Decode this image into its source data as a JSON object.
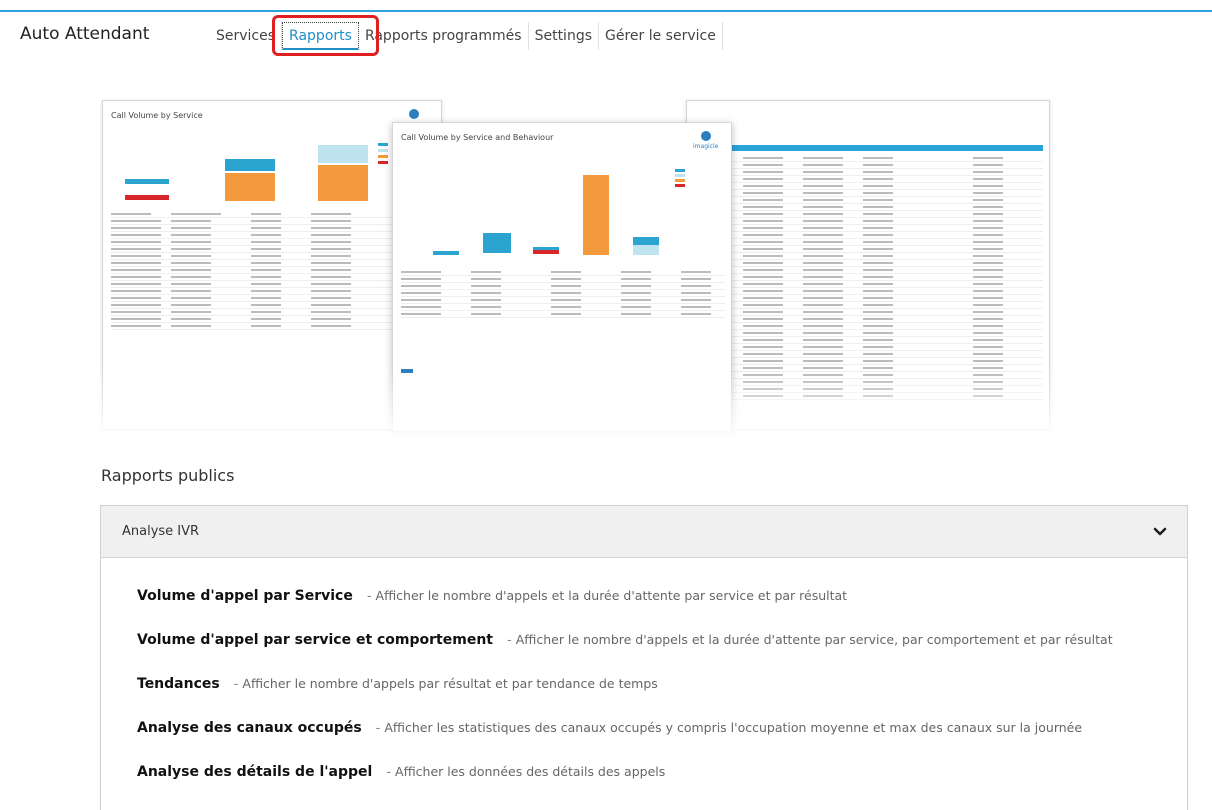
{
  "app": {
    "title": "Auto Attendant"
  },
  "nav": {
    "tabs": [
      {
        "label": "Services",
        "active": false
      },
      {
        "label": "Rapports",
        "active": true
      },
      {
        "label": "Rapports programmés",
        "active": false
      },
      {
        "label": "Settings",
        "active": false
      },
      {
        "label": "Gérer le service",
        "active": false
      }
    ]
  },
  "preview": {
    "left_doc_title": "Call Volume by Service",
    "center_doc_title": "Call Volume by Service and Behaviour",
    "logo_text": "imagicle"
  },
  "section": {
    "title": "Rapports publics"
  },
  "panel": {
    "title": "Analyse IVR",
    "reports": [
      {
        "name": "Volume d'appel par Service",
        "separator": "-",
        "description": "Afficher le nombre d'appels et la durée d'attente par service et par résultat"
      },
      {
        "name": "Volume d'appel par service et comportement",
        "separator": "-",
        "description": "Afficher le nombre d'appels et la durée d'attente par service, par comportement et par résultat"
      },
      {
        "name": "Tendances",
        "separator": "-",
        "description": "Afficher le nombre d'appels par résultat et par tendance de temps"
      },
      {
        "name": "Analyse des canaux occupés",
        "separator": "-",
        "description": "Afficher les statistiques des canaux occupés y compris l'occupation moyenne et max des canaux sur la journée"
      },
      {
        "name": "Analyse des détails de l'appel",
        "separator": "-",
        "description": "Afficher les données des détails des appels"
      }
    ]
  },
  "colors": {
    "accent": "#2aa3d8",
    "highlight": "#e02020",
    "bar_blue": "#2ba5cf",
    "bar_orange": "#f39a3c",
    "bar_red": "#d9262b",
    "bar_light": "#bfe3ef"
  }
}
